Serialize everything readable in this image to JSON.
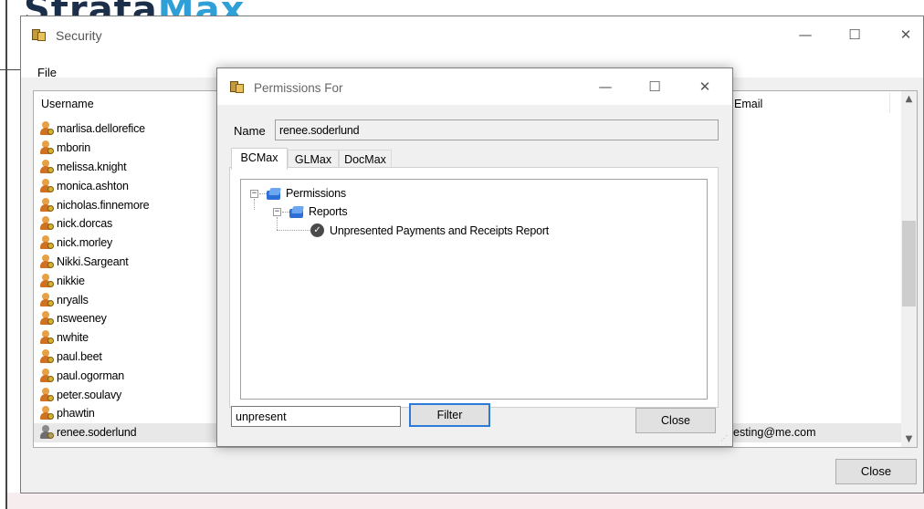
{
  "background": {
    "logo_part1": "Strata",
    "logo_part2": "Max"
  },
  "main_window": {
    "title": "Security",
    "menu_file": "File",
    "columns": {
      "username": "Username",
      "email": "Email"
    },
    "users": [
      "marlisa.dellorefice",
      "mborin",
      "melissa.knight",
      "monica.ashton",
      "nicholas.finnemore",
      "nick.dorcas",
      "nick.morley",
      "Nikki.Sargeant",
      "nikkie",
      "nryalls",
      "nsweeney",
      "nwhite",
      "paul.beet",
      "paul.ogorman",
      "peter.soulavy",
      "phawtin",
      "renee.soderlund"
    ],
    "selected_user_email": "esting@me.com",
    "close_label": "Close"
  },
  "dialog": {
    "title": "Permissions For",
    "name_label": "Name",
    "name_value": "renee.soderlund",
    "tabs": [
      "BCMax",
      "GLMax",
      "DocMax"
    ],
    "active_tab": "BCMax",
    "tree": {
      "root": "Permissions",
      "child": "Reports",
      "leaf": "Unpresented Payments and Receipts Report"
    },
    "filter_value": "unpresent",
    "filter_label": "Filter",
    "close_label": "Close"
  },
  "colors": {
    "accent_focus": "#2e7ad8",
    "folder_blue": "#2c6fd6",
    "logo_dark": "#1b2f4a",
    "logo_light": "#2f9fd8"
  },
  "icons": {
    "window_icon": "security-app-icon",
    "user_icon": "user-key-icon",
    "folder_icon": "folder-icon",
    "granted_icon": "check-circle-icon"
  }
}
